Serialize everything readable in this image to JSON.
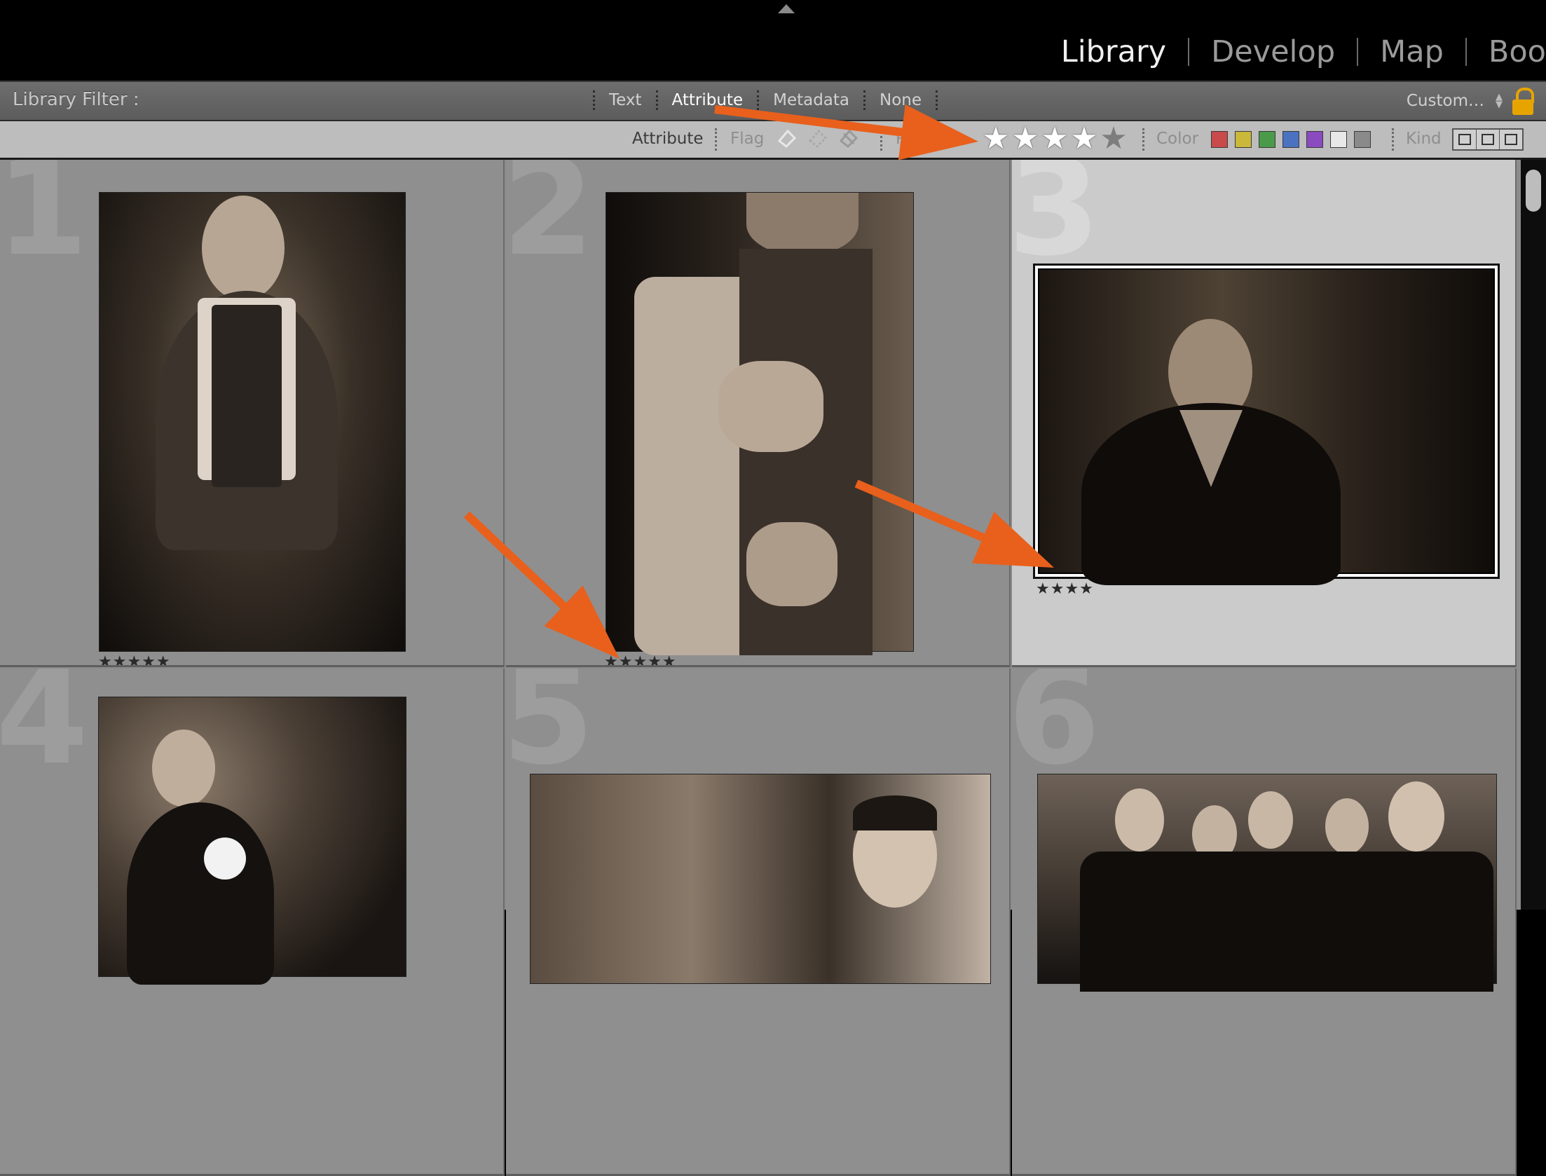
{
  "modules": [
    "Library",
    "Develop",
    "Map",
    "Boo"
  ],
  "active_module": "Library",
  "filter_bar": {
    "title": "Library Filter :",
    "tabs": [
      "Text",
      "Attribute",
      "Metadata",
      "None"
    ],
    "active_tab": "Attribute",
    "preset": "Custom…"
  },
  "attribute_row": {
    "label": "Attribute",
    "flag_label": "Flag",
    "rating_label": "Rati",
    "rating_filter": 4,
    "rating_stars": [
      "★",
      "★",
      "★",
      "★",
      "★"
    ],
    "color_label": "Color",
    "color_swatches": [
      "#c84a4a",
      "#c9b83a",
      "#4a9a4a",
      "#4a72c0",
      "#8a4ac0",
      "#e8e8e8",
      "#8a8a8a"
    ],
    "kind_label": "Kind"
  },
  "grid": {
    "cells": [
      {
        "index": "1",
        "rating_text": "★★★★★"
      },
      {
        "index": "2",
        "rating_text": "★★★★★"
      },
      {
        "index": "3",
        "rating_text": "★★★★",
        "selected": true
      },
      {
        "index": "4",
        "rating_text": ""
      },
      {
        "index": "5",
        "rating_text": ""
      },
      {
        "index": "6",
        "rating_text": ""
      }
    ]
  },
  "annotation_color": "#e8601c"
}
